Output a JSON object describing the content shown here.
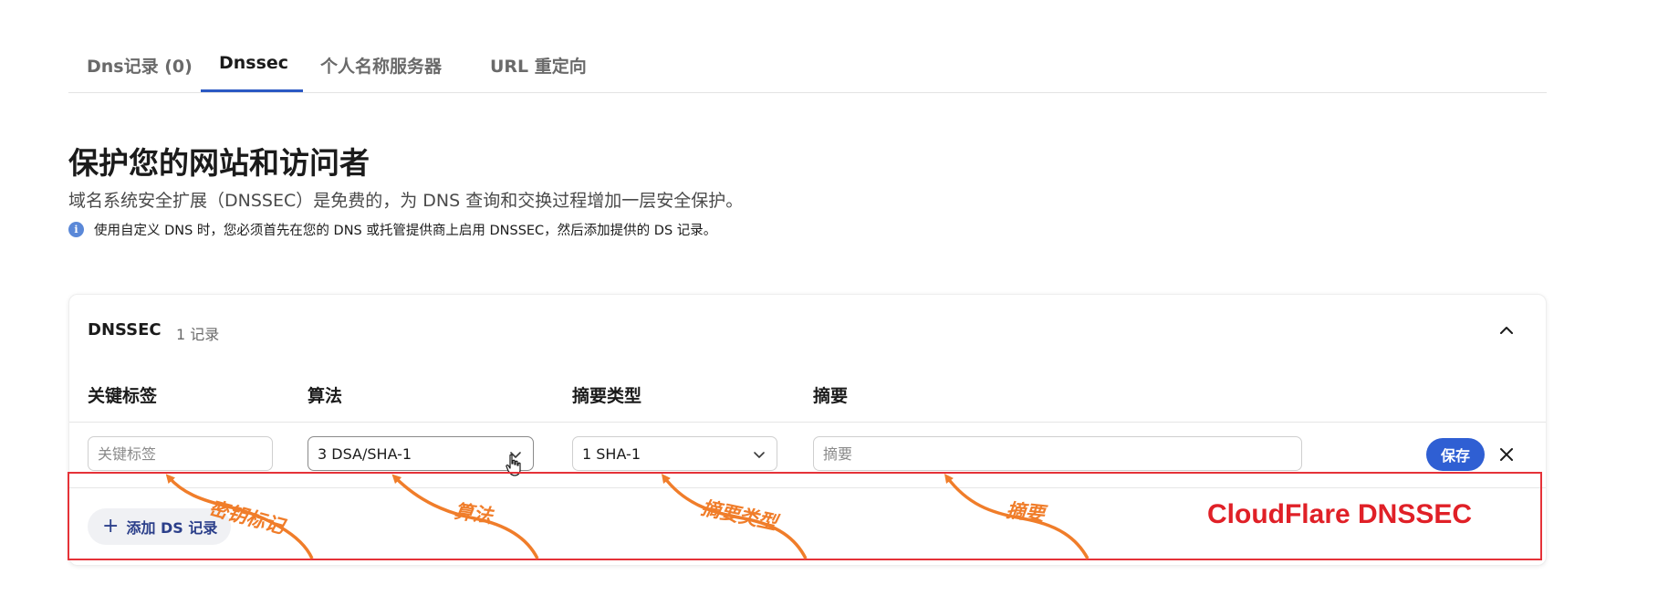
{
  "tabs": [
    {
      "label": "Dns记录 (0)"
    },
    {
      "label": "Dnssec"
    },
    {
      "label": "个人名称服务器"
    },
    {
      "label": "URL 重定向"
    }
  ],
  "active_tab": "Dnssec",
  "page": {
    "title": "保护您的网站和访问者",
    "description": "域名系统安全扩展（DNSSEC）是免费的，为 DNS 查询和交换过程增加一层安全保护。",
    "info": "使用自定义 DNS 时，您必须首先在您的 DNS 或托管提供商上启用 DNSSEC，然后添加提供的 DS 记录。"
  },
  "card": {
    "title": "DNSSEC",
    "count": "1 记录",
    "columns": [
      "关键标签",
      "算法",
      "摘要类型",
      "摘要"
    ],
    "row": {
      "key_tag_placeholder": "关键标签",
      "key_tag_value": "",
      "algorithm": "3 DSA/SHA-1",
      "digest_type": "1 SHA-1",
      "digest_placeholder": "摘要",
      "digest_value": ""
    },
    "save_label": "保存",
    "add_label": "添加 DS 记录"
  },
  "annotations": {
    "title": "CloudFlare DNSSEC",
    "labels": [
      "密钥标记",
      "算法",
      "摘要类型",
      "摘要"
    ],
    "color_box": "#e53238",
    "color_arrow": "#f07d2a"
  },
  "colors": {
    "accent": "#2f5fd3",
    "tab_underline": "#2b59c3"
  }
}
